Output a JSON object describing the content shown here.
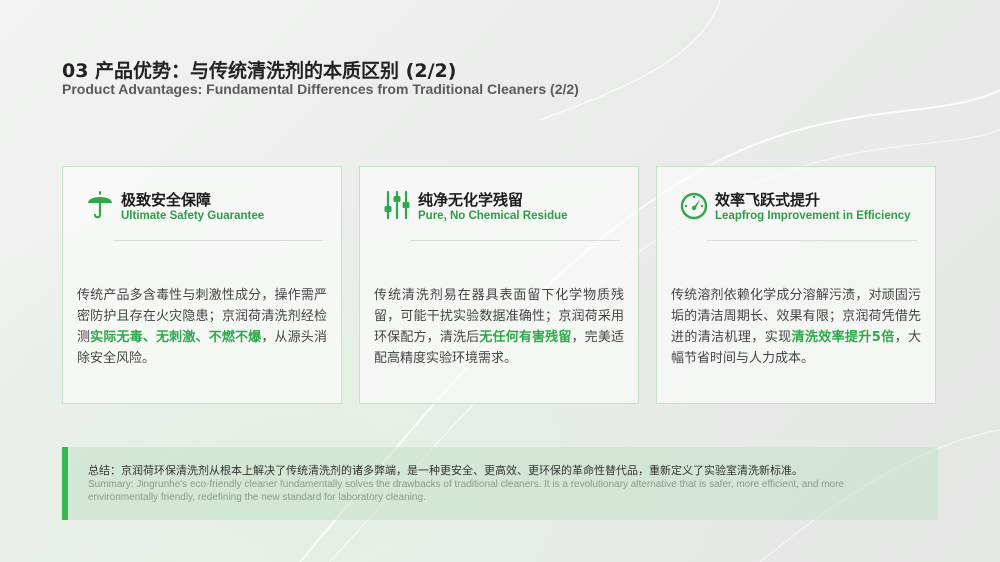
{
  "header": {
    "title_cn": "03 产品优势：与传统清洗剂的本质区别 (2/2)",
    "title_en": "Product Advantages: Fundamental Differences from Traditional Cleaners (2/2)"
  },
  "cards": [
    {
      "icon": "umbrella-icon",
      "title": "极致安全保障",
      "subtitle": "Ultimate Safety Guarantee",
      "body_pre": "传统产品多含毒性与刺激性成分，操作需严密防护且存在火灾隐患；京润荷清洗剂经检测",
      "body_highlight": "实际无毒、无刺激、不燃不爆",
      "body_post": "，从源头消除安全风险。"
    },
    {
      "icon": "sliders-icon",
      "title": "纯净无化学残留",
      "subtitle": "Pure, No Chemical Residue",
      "body_pre": "传统清洗剂易在器具表面留下化学物质残留，可能干扰实验数据准确性；京润荷采用环保配方，清洗后",
      "body_highlight": "无任何有害残留",
      "body_post": "，完美适配高精度实验环境需求。"
    },
    {
      "icon": "speedometer-icon",
      "title": "效率飞跃式提升",
      "subtitle": "Leapfrog Improvement in Efficiency",
      "body_pre": "传统溶剂依赖化学成分溶解污渍，对顽固污垢的清洁周期长、效果有限；京润荷凭借先进的清洁机理，实现",
      "body_highlight": "清洗效率提升5倍",
      "body_post": "，大幅节省时间与人力成本。"
    }
  ],
  "summary": {
    "cn": "总结：京润荷环保清洗剂从根本上解决了传统清洗剂的诸多弊端，是一种更安全、更高效、更环保的革命性替代品，重新定义了实验室清洗新标准。",
    "en": "Summary: Jingrunhe's eco-friendly cleaner fundamentally solves the drawbacks of traditional cleaners. It is a revolutionary alternative that is safer, more efficient, and more environmentally friendly, redefining the new standard for laboratory cleaning."
  },
  "colors": {
    "accent": "#2ea84a",
    "card_border": "#bfe5c6",
    "summary_bg": "#c3e1c8"
  }
}
